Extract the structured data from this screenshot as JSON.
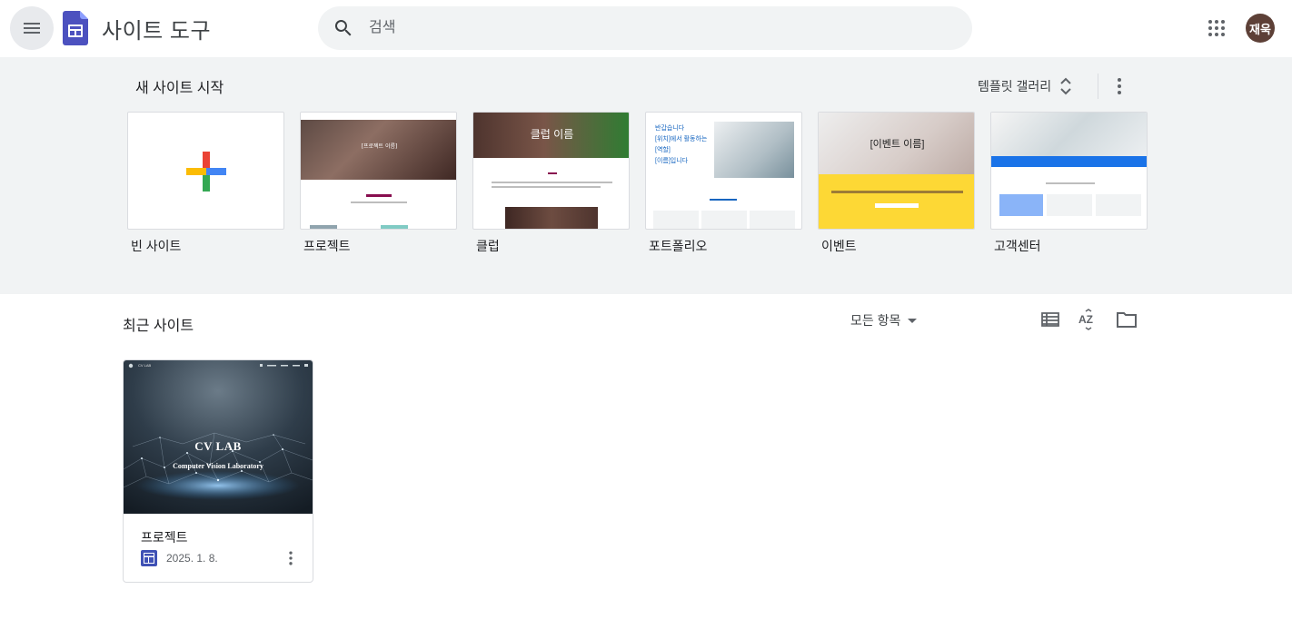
{
  "header": {
    "app_title": "사이트 도구",
    "search_placeholder": "검색",
    "avatar_text": "재욱"
  },
  "templates": {
    "title": "새 사이트 시작",
    "gallery_label": "템플릿 갤러리",
    "items": [
      {
        "label": "빈 사이트"
      },
      {
        "label": "프로젝트",
        "thumb_heading": "[프로젝트 이름]"
      },
      {
        "label": "클럽",
        "thumb_heading": "클럽 이름"
      },
      {
        "label": "포트폴리오",
        "thumb_lines": [
          "반갑습니다",
          "[위치]에서 활동하는",
          "[역할]",
          "[이름]입니다"
        ]
      },
      {
        "label": "이벤트",
        "thumb_heading": "[이벤트 이름]"
      },
      {
        "label": "고객센터"
      }
    ]
  },
  "recent": {
    "title": "최근 사이트",
    "owner_filter": "모든 항목",
    "sites": [
      {
        "name": "프로젝트",
        "date": "2025. 1. 8.",
        "thumb_title": "CV LAB",
        "thumb_subtitle": "Computer Vision Laboratory",
        "thumb_nav_brand": "CV LAB"
      }
    ]
  },
  "colors": {
    "accent": "#4c51bf",
    "sites_blue": "#3f51b5",
    "avatar_bg": "#5d4037",
    "templates_bg": "#f1f3f4"
  }
}
